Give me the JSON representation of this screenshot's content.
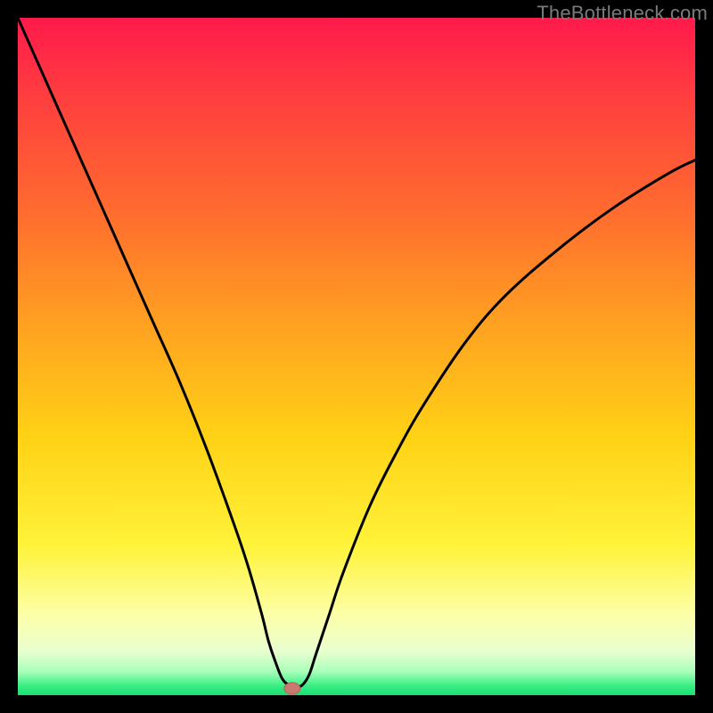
{
  "watermark": {
    "text": "TheBottleneck.com"
  },
  "colors": {
    "gradient_stops": [
      {
        "offset": 0.0,
        "color": "#ff1a4b"
      },
      {
        "offset": 0.12,
        "color": "#ff3f3f"
      },
      {
        "offset": 0.28,
        "color": "#ff6a2f"
      },
      {
        "offset": 0.45,
        "color": "#ffa021"
      },
      {
        "offset": 0.62,
        "color": "#ffd215"
      },
      {
        "offset": 0.78,
        "color": "#fff33a"
      },
      {
        "offset": 0.88,
        "color": "#fdffa6"
      },
      {
        "offset": 0.935,
        "color": "#e9ffd0"
      },
      {
        "offset": 0.965,
        "color": "#a8ffba"
      },
      {
        "offset": 0.985,
        "color": "#3eef86"
      },
      {
        "offset": 1.0,
        "color": "#18e072"
      }
    ],
    "curve": "#000000",
    "marker_fill": "#c87a6e",
    "marker_stroke": "#b06258",
    "frame_bg": "#000000"
  },
  "chart_data": {
    "type": "line",
    "title": "",
    "xlabel": "",
    "ylabel": "",
    "xlim": [
      0,
      100
    ],
    "ylim": [
      0,
      100
    ],
    "note": "Axes are unlabeled; x is a normalized horizontal position (0 left edge, 100 right edge of the colored plot area) and y is normalized bottleneck percentage (0 at bottom/green, 100 at top/red). Values are estimated from pixel positions.",
    "series": [
      {
        "name": "bottleneck-curve",
        "x": [
          0,
          4,
          8,
          12,
          16,
          20,
          24,
          28,
          32,
          34,
          36,
          37,
          38,
          39,
          40,
          41,
          42,
          43,
          44,
          46,
          48,
          52,
          56,
          60,
          66,
          72,
          80,
          88,
          96,
          100
        ],
        "y": [
          100,
          91,
          82,
          73,
          64,
          55,
          46,
          36,
          25,
          19,
          12,
          8,
          5,
          2.5,
          1.5,
          1.2,
          1.5,
          3,
          6,
          12,
          18,
          28,
          36,
          43,
          52,
          59,
          66,
          72,
          77,
          79
        ]
      }
    ],
    "marker": {
      "x": 40.5,
      "y": 1.0,
      "label": ""
    }
  }
}
